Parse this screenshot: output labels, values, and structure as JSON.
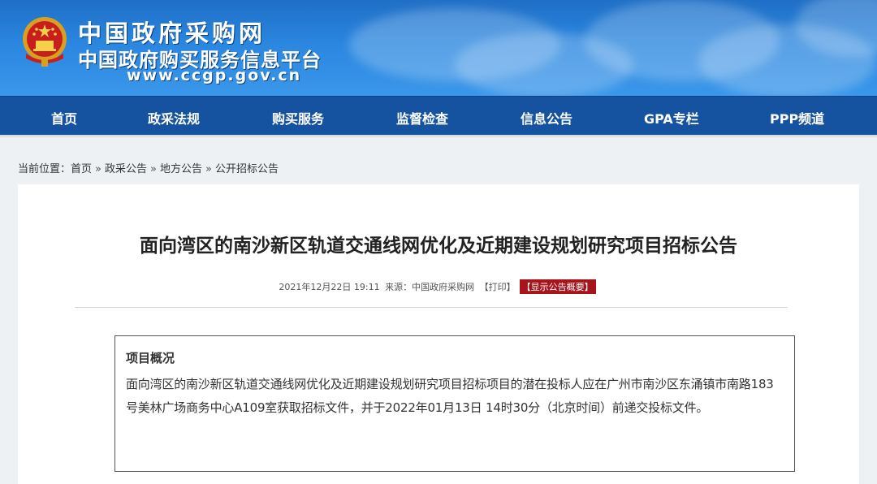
{
  "header": {
    "site_name": "中国政府采购网",
    "site_subtitle": "中国政府购买服务信息平台",
    "site_url": "www.ccgp.gov.cn",
    "emblem_icon": "national-emblem-icon"
  },
  "nav": {
    "items": [
      {
        "label": "首页"
      },
      {
        "label": "政采法规"
      },
      {
        "label": "购买服务"
      },
      {
        "label": "监督检查"
      },
      {
        "label": "信息公告"
      },
      {
        "label": "GPA专栏"
      },
      {
        "label": "PPP频道"
      }
    ]
  },
  "breadcrumb": {
    "prefix": "当前位置：",
    "items": [
      "首页",
      "政采公告",
      "地方公告",
      "公开招标公告"
    ],
    "separator": "»"
  },
  "article": {
    "title": "面向湾区的南沙新区轨道交通线网优化及近期建设规划研究项目招标公告",
    "date": "2021年12月22日 19:11",
    "source_label": "来源：",
    "source": "中国政府采购网",
    "print_label": "【打印】",
    "summary_toggle_label": "【显示公告概要】",
    "summary_heading": "项目概况",
    "summary_text": "面向湾区的南沙新区轨道交通线网优化及近期建设规划研究项目招标项目的潜在投标人应在广州市南沙区东涌镇市南路183号美林广场商务中心A109室获取招标文件，并于2022年01月13日 14时30分（北京时间）前递交投标文件。"
  },
  "colors": {
    "banner_blue": "#2a86df",
    "nav_blue": "#1553a0",
    "badge_red": "#a8141b"
  }
}
